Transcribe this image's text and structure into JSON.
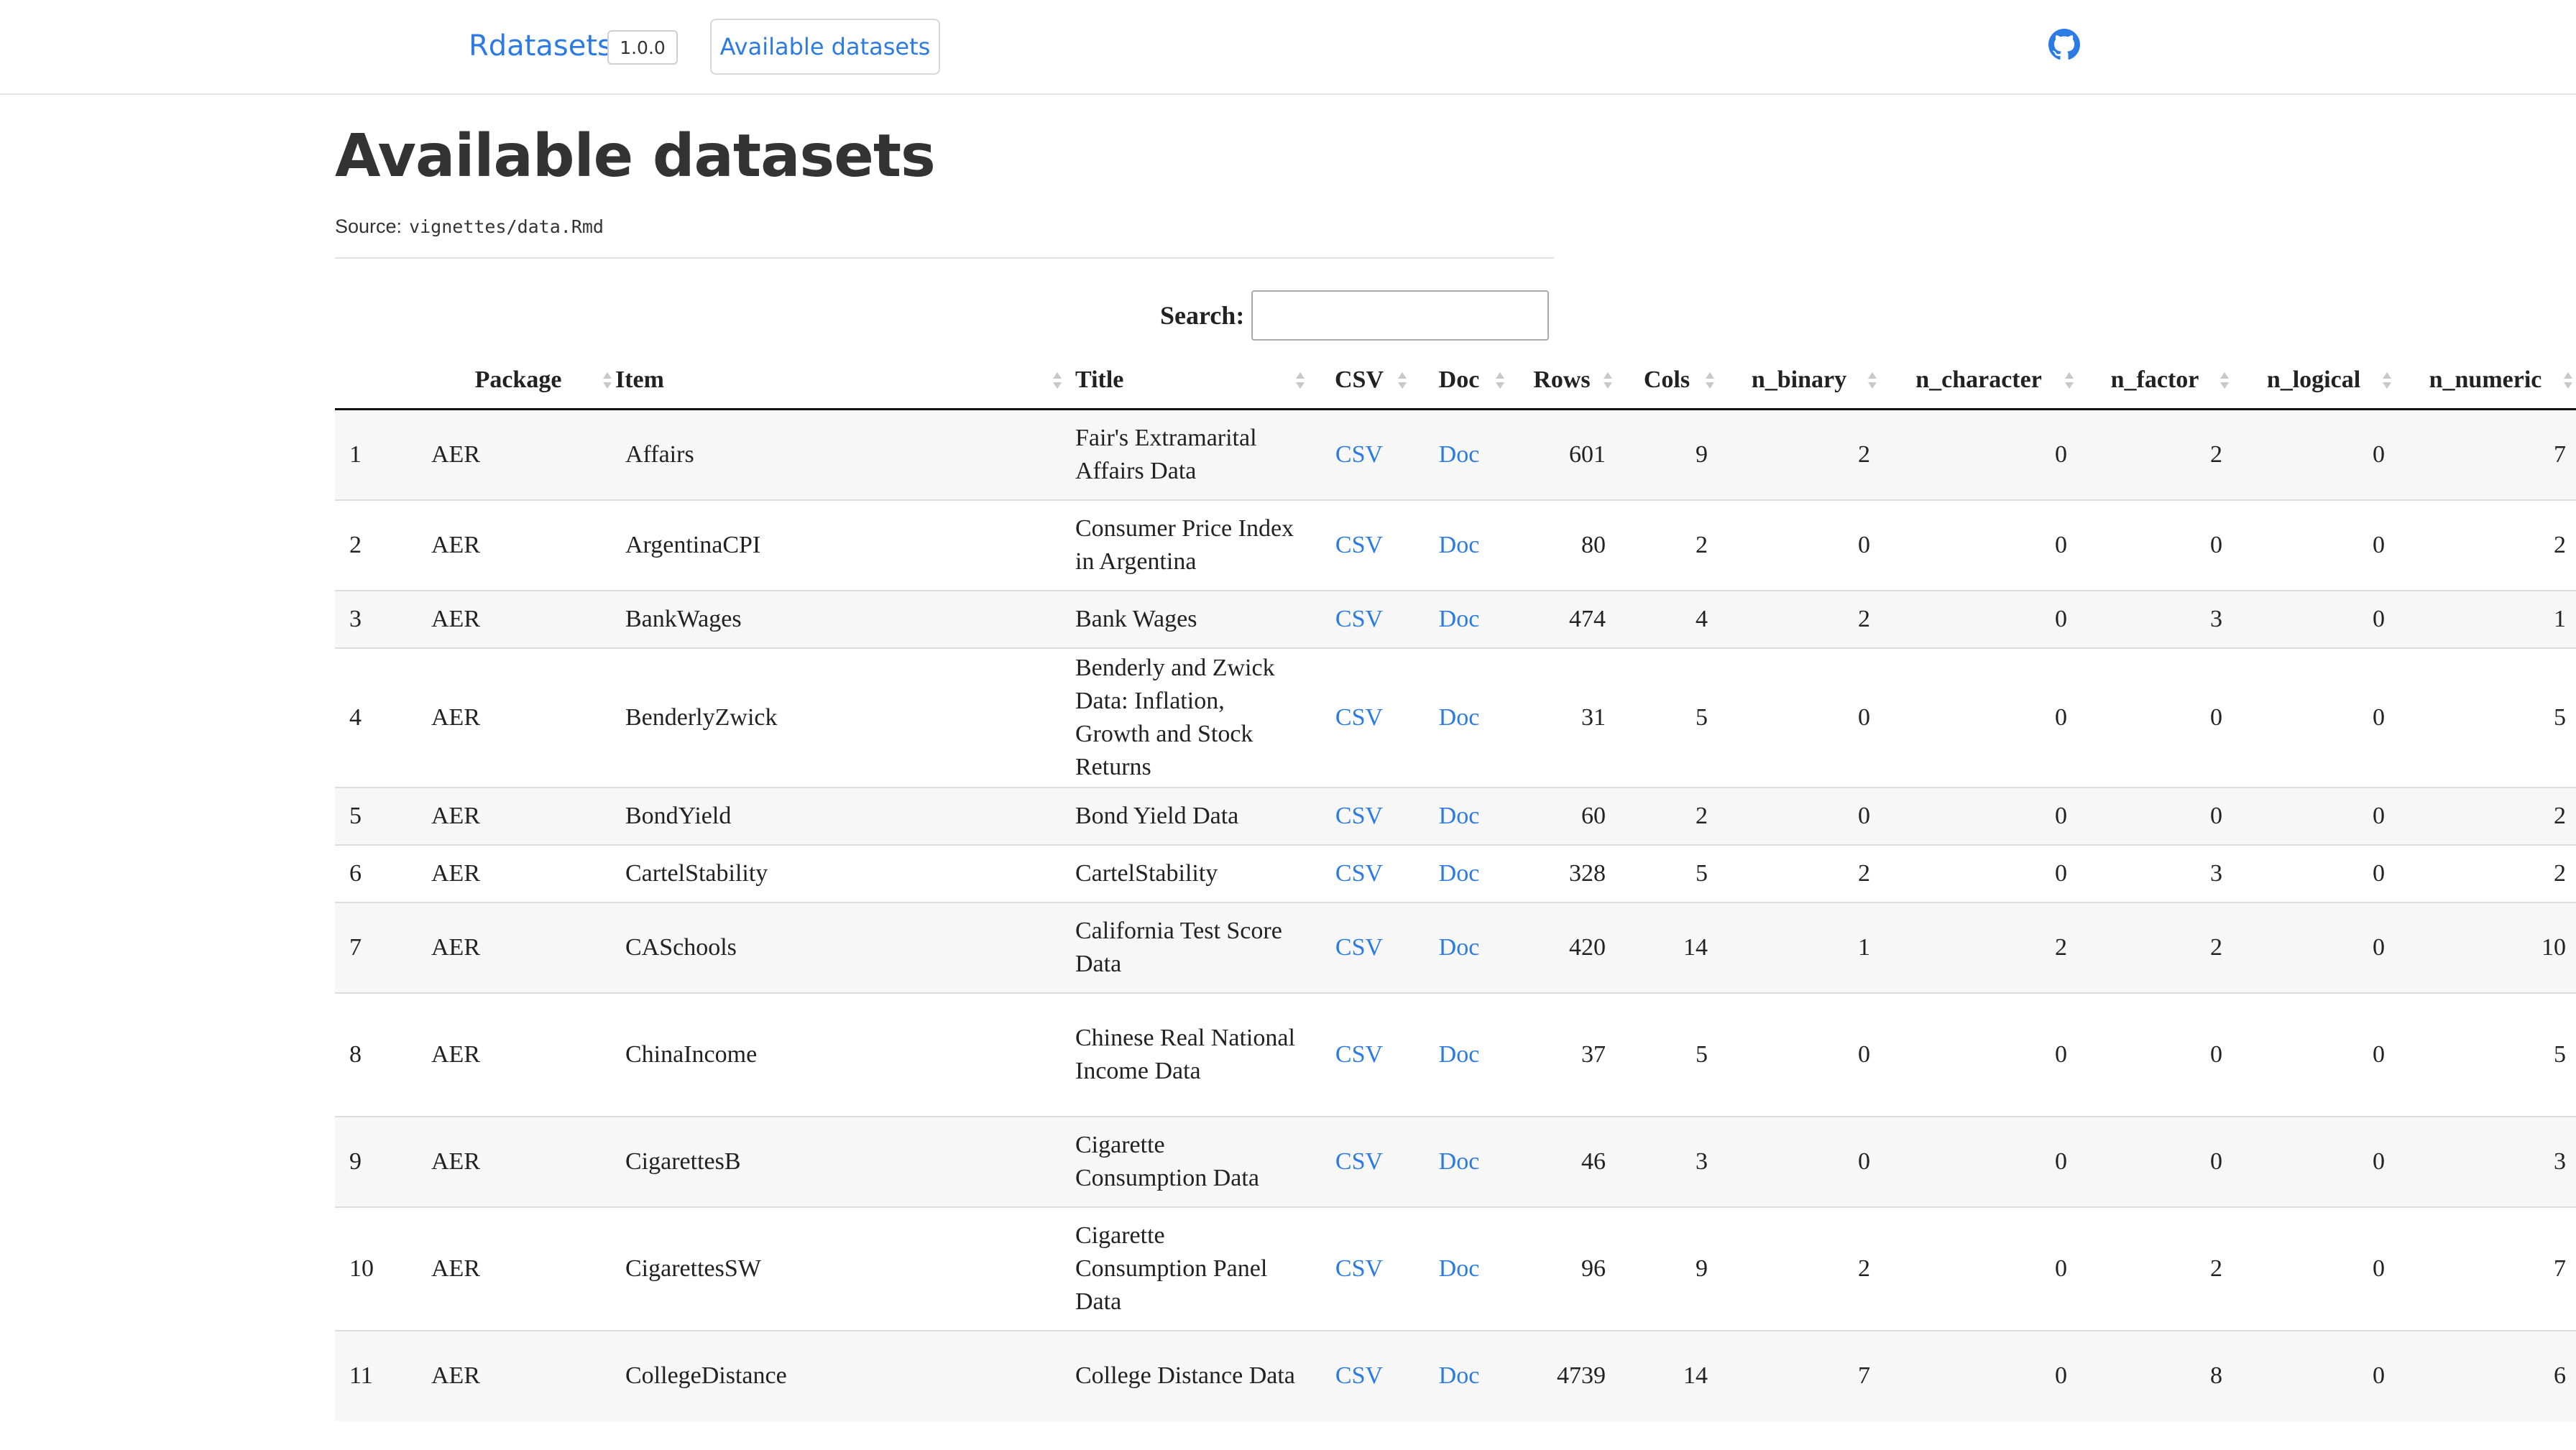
{
  "nav": {
    "brand": "Rdatasets",
    "version": "1.0.0",
    "link": "Available datasets",
    "github_icon": "github-icon"
  },
  "page": {
    "title": "Available datasets",
    "source_label": "Source:",
    "source_path": "vignettes/data.Rmd"
  },
  "search": {
    "label": "Search:",
    "value": ""
  },
  "columns": [
    "",
    "Package",
    "Item",
    "Title",
    "CSV",
    "Doc",
    "Rows",
    "Cols",
    "n_binary",
    "n_character",
    "n_factor",
    "n_logical",
    "n_numeric"
  ],
  "rows": [
    {
      "idx": "1",
      "pkg": "AER",
      "item": "Affairs",
      "title": "Fair's Extramarital Affairs Data",
      "csv": "CSV",
      "doc": "Doc",
      "rows": "601",
      "cols": "9",
      "n_binary": "2",
      "n_character": "0",
      "n_factor": "2",
      "n_logical": "0",
      "n_numeric": "7"
    },
    {
      "idx": "2",
      "pkg": "AER",
      "item": "ArgentinaCPI",
      "title": "Consumer Price Index in Argentina",
      "csv": "CSV",
      "doc": "Doc",
      "rows": "80",
      "cols": "2",
      "n_binary": "0",
      "n_character": "0",
      "n_factor": "0",
      "n_logical": "0",
      "n_numeric": "2"
    },
    {
      "idx": "3",
      "pkg": "AER",
      "item": "BankWages",
      "title": "Bank Wages",
      "csv": "CSV",
      "doc": "Doc",
      "rows": "474",
      "cols": "4",
      "n_binary": "2",
      "n_character": "0",
      "n_factor": "3",
      "n_logical": "0",
      "n_numeric": "1"
    },
    {
      "idx": "4",
      "pkg": "AER",
      "item": "BenderlyZwick",
      "title": "Benderly and Zwick Data: Inflation, Growth and Stock Returns",
      "csv": "CSV",
      "doc": "Doc",
      "rows": "31",
      "cols": "5",
      "n_binary": "0",
      "n_character": "0",
      "n_factor": "0",
      "n_logical": "0",
      "n_numeric": "5"
    },
    {
      "idx": "5",
      "pkg": "AER",
      "item": "BondYield",
      "title": "Bond Yield Data",
      "csv": "CSV",
      "doc": "Doc",
      "rows": "60",
      "cols": "2",
      "n_binary": "0",
      "n_character": "0",
      "n_factor": "0",
      "n_logical": "0",
      "n_numeric": "2"
    },
    {
      "idx": "6",
      "pkg": "AER",
      "item": "CartelStability",
      "title": "CartelStability",
      "csv": "CSV",
      "doc": "Doc",
      "rows": "328",
      "cols": "5",
      "n_binary": "2",
      "n_character": "0",
      "n_factor": "3",
      "n_logical": "0",
      "n_numeric": "2"
    },
    {
      "idx": "7",
      "pkg": "AER",
      "item": "CASchools",
      "title": "California Test Score Data",
      "csv": "CSV",
      "doc": "Doc",
      "rows": "420",
      "cols": "14",
      "n_binary": "1",
      "n_character": "2",
      "n_factor": "2",
      "n_logical": "0",
      "n_numeric": "10"
    },
    {
      "idx": "8",
      "pkg": "AER",
      "item": "ChinaIncome",
      "title": "Chinese Real National Income Data",
      "csv": "CSV",
      "doc": "Doc",
      "rows": "37",
      "cols": "5",
      "n_binary": "0",
      "n_character": "0",
      "n_factor": "0",
      "n_logical": "0",
      "n_numeric": "5"
    },
    {
      "idx": "9",
      "pkg": "AER",
      "item": "CigarettesB",
      "title": "Cigarette Consumption Data",
      "csv": "CSV",
      "doc": "Doc",
      "rows": "46",
      "cols": "3",
      "n_binary": "0",
      "n_character": "0",
      "n_factor": "0",
      "n_logical": "0",
      "n_numeric": "3"
    },
    {
      "idx": "10",
      "pkg": "AER",
      "item": "CigarettesSW",
      "title": "Cigarette Consumption Panel Data",
      "csv": "CSV",
      "doc": "Doc",
      "rows": "96",
      "cols": "9",
      "n_binary": "2",
      "n_character": "0",
      "n_factor": "2",
      "n_logical": "0",
      "n_numeric": "7"
    },
    {
      "idx": "11",
      "pkg": "AER",
      "item": "CollegeDistance",
      "title": "College Distance Data",
      "csv": "CSV",
      "doc": "Doc",
      "rows": "4739",
      "cols": "14",
      "n_binary": "7",
      "n_character": "0",
      "n_factor": "8",
      "n_logical": "0",
      "n_numeric": "6"
    }
  ]
}
